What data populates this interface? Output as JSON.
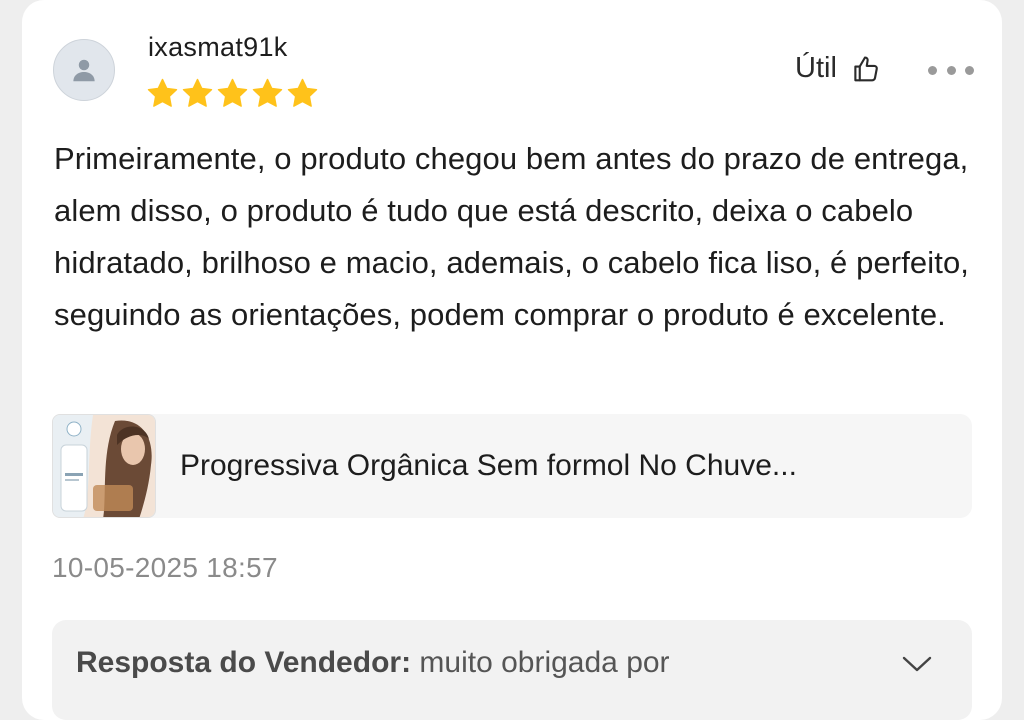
{
  "review": {
    "username": "ixasmat91k",
    "rating": 5,
    "rating_max": 5,
    "useful_label": "Útil",
    "text": "Primeiramente, o produto chegou bem antes do prazo de entrega, alem disso, o produto é tudo que está descrito, deixa o cabelo hidratado, brilhoso e macio, ademais, o cabelo fica liso, é perfeito, seguindo as orientações, podem comprar o produto é excelente.",
    "date": "10-05-2025 18:57"
  },
  "product": {
    "name": "Progressiva Orgânica Sem formol No Chuve..."
  },
  "seller_reply": {
    "label": "Resposta do Vendedor:",
    "text": " muito obrigada por"
  },
  "colors": {
    "star": "#ffc21a",
    "page_bg": "#eeeeee",
    "card_bg": "#ffffff"
  },
  "icons": [
    "user-icon",
    "star-icon",
    "thumbs-up-icon",
    "more-options-icon",
    "chevron-down-icon"
  ]
}
